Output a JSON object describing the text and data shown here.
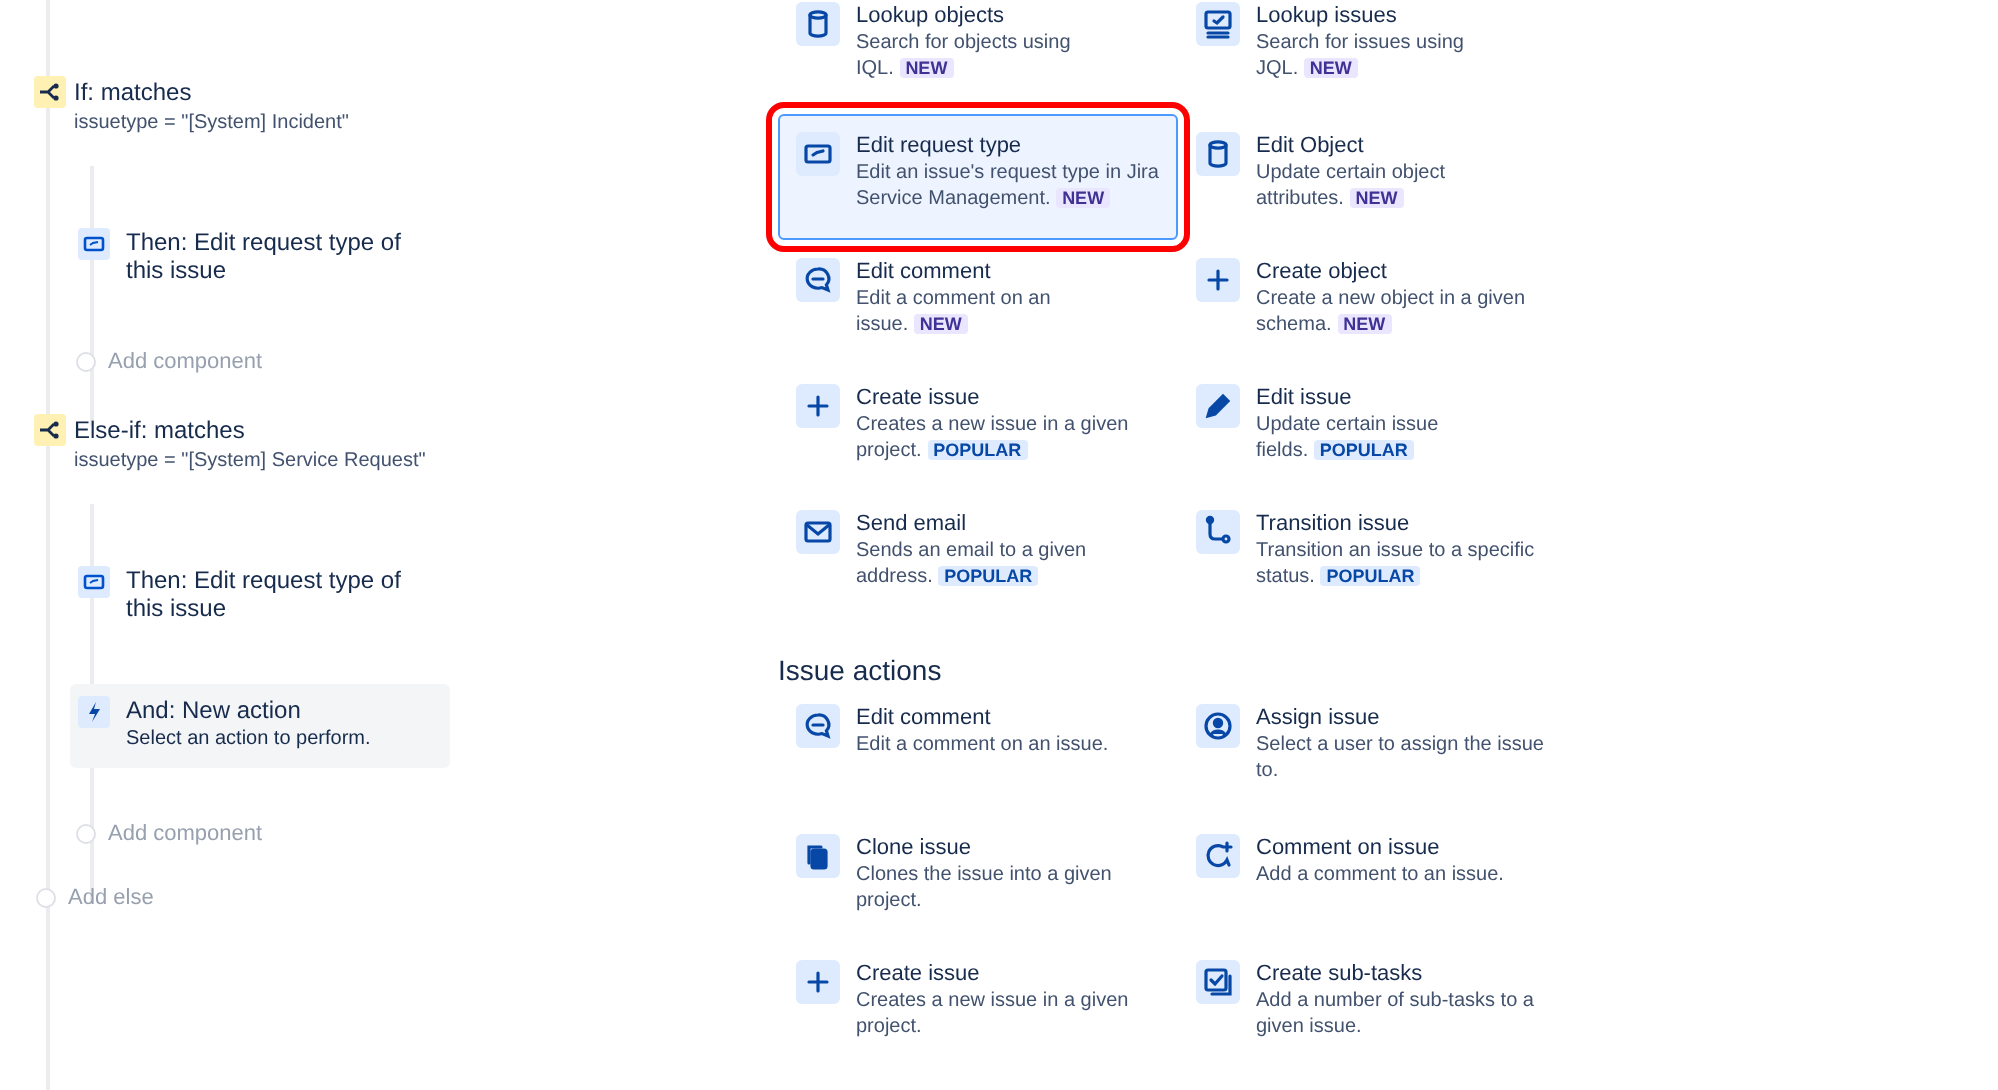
{
  "flow": [
    {
      "kind": "condition",
      "title": "If: matches",
      "subtitle": "issuetype = \"[System] Incident\"",
      "children": [
        {
          "kind": "action",
          "title": "Then: Edit request type of this issue"
        }
      ],
      "add": "Add component"
    },
    {
      "kind": "condition",
      "title": "Else-if: matches",
      "subtitle": "issuetype = \"[System] Service Request\"",
      "children": [
        {
          "kind": "action",
          "title": "Then: Edit request type of this issue"
        },
        {
          "kind": "new",
          "title": "And: New action",
          "subtitle": "Select an action to perform."
        }
      ],
      "add": "Add component"
    }
  ],
  "add_else": "Add else",
  "actions": [
    {
      "kind": "cylinder",
      "title": "Lookup objects",
      "desc": "Search for objects using IQL.",
      "badge": {
        "kind": "new",
        "text": "NEW"
      },
      "selected": false
    },
    {
      "kind": "monitor",
      "title": "Lookup issues",
      "desc": "Search for issues using JQL.",
      "badge": {
        "kind": "new",
        "text": "NEW"
      },
      "selected": false
    },
    {
      "kind": "request",
      "title": "Edit request type",
      "desc": "Edit an issue's request type in Jira Service Management.",
      "badge": {
        "kind": "new",
        "text": "NEW"
      },
      "selected": true
    },
    {
      "kind": "cylinder",
      "title": "Edit Object",
      "desc": "Update certain object attributes.",
      "badge": {
        "kind": "new",
        "text": "NEW"
      },
      "selected": false
    },
    {
      "kind": "comment",
      "title": "Edit comment",
      "desc": "Edit a comment on an issue.",
      "badge": {
        "kind": "new",
        "text": "NEW"
      },
      "selected": false
    },
    {
      "kind": "plus",
      "title": "Create object",
      "desc": "Create a new object in a given schema.",
      "badge": {
        "kind": "new",
        "text": "NEW"
      },
      "selected": false
    },
    {
      "kind": "plus",
      "title": "Create issue",
      "desc": "Creates a new issue in a given project.",
      "badge": {
        "kind": "popular",
        "text": "POPULAR"
      },
      "selected": false
    },
    {
      "kind": "pencil",
      "title": "Edit issue",
      "desc": "Update certain issue fields.",
      "badge": {
        "kind": "popular",
        "text": "POPULAR"
      },
      "selected": false
    },
    {
      "kind": "mail",
      "title": "Send email",
      "desc": "Sends an email to a given address.",
      "badge": {
        "kind": "popular",
        "text": "POPULAR"
      },
      "selected": false
    },
    {
      "kind": "transition",
      "title": "Transition issue",
      "desc": "Transition an issue to a specific status.",
      "badge": {
        "kind": "popular",
        "text": "POPULAR"
      },
      "selected": false
    }
  ],
  "issue_actions": {
    "heading": "Issue actions",
    "items": [
      {
        "kind": "comment",
        "title": "Edit comment",
        "desc": "Edit a comment on an issue.",
        "selected": false
      },
      {
        "kind": "user",
        "title": "Assign issue",
        "desc": "Select a user to assign the issue to.",
        "selected": false
      },
      {
        "kind": "copy",
        "title": "Clone issue",
        "desc": "Clones the issue into a given project.",
        "selected": false
      },
      {
        "kind": "comment-add",
        "title": "Comment on issue",
        "desc": "Add a comment to an issue.",
        "selected": false
      },
      {
        "kind": "plus",
        "title": "Create issue",
        "desc": "Creates a new issue in a given project.",
        "selected": false
      },
      {
        "kind": "subtasks",
        "title": "Create sub-tasks",
        "desc": "Add a number of sub-tasks to a given issue.",
        "selected": false
      }
    ]
  }
}
